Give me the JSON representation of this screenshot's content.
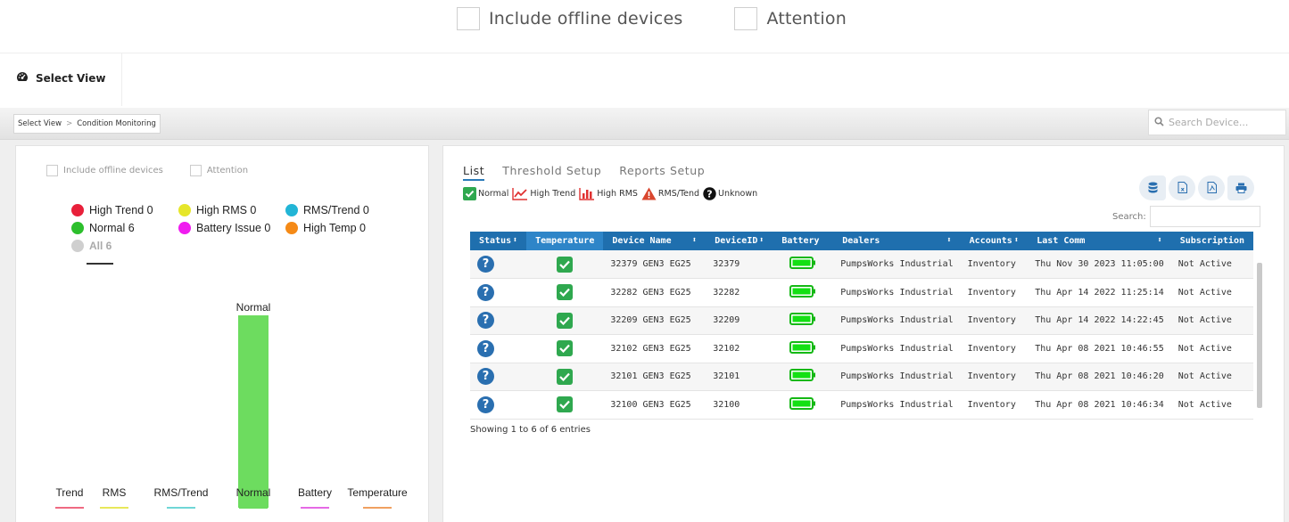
{
  "top_filters": {
    "include_offline_label": "Include offline devices",
    "attention_label": "Attention"
  },
  "header": {
    "title": "Select View",
    "title_icon": "dashboard-icon"
  },
  "breadcrumb": {
    "items": [
      "Select View",
      "Condition Monitoring"
    ],
    "separator": ">"
  },
  "search_device": {
    "placeholder": "Search Device..."
  },
  "left_panel": {
    "filters": {
      "include_offline_label": "Include offline devices",
      "attention_label": "Attention"
    },
    "legend": [
      {
        "label": "High Trend 0",
        "color": "#e8203a"
      },
      {
        "label": "High RMS 0",
        "color": "#e6e62a"
      },
      {
        "label": "RMS/Trend 0",
        "color": "#22b5d6"
      },
      {
        "label": "Normal 6",
        "color": "#2cbf2c"
      },
      {
        "label": "Battery Issue 0",
        "color": "#f01cf0"
      },
      {
        "label": "High Temp 0",
        "color": "#f58a17"
      }
    ],
    "all_label": "All 6"
  },
  "chart_data": {
    "type": "bar",
    "categories": [
      "Trend",
      "RMS",
      "RMS/Trend",
      "Normal",
      "Battery",
      "Temperature"
    ],
    "values": [
      0,
      0,
      0,
      6,
      0,
      0
    ],
    "bar_labels": [
      "",
      "",
      "",
      "Normal",
      "",
      ""
    ],
    "colors": [
      "#ef6a82",
      "#e8e85a",
      "#6fd6d6",
      "#6ddc5f",
      "#e56ae5",
      "#f0a060"
    ],
    "ylim": [
      0,
      6
    ],
    "grid": false
  },
  "right_panel": {
    "tabs": [
      "List",
      "Threshold Setup",
      "Reports Setup"
    ],
    "active_tab": "List",
    "status_legend": [
      "Normal",
      "High Trend",
      "High RMS",
      "RMS/Tend",
      "Unknown"
    ],
    "search_label": "Search:",
    "columns": [
      "Status",
      "Temperature",
      "Device Name",
      "DeviceID",
      "Battery",
      "Dealers",
      "Accounts",
      "Last Comm",
      "Subscription"
    ],
    "rows": [
      {
        "device_name": "32379 GEN3 EG25",
        "device_id": "32379",
        "dealer": "PumpsWorks Industrial",
        "account": "Inventory",
        "last_comm": "Thu Nov 30 2023 11:05:00",
        "subscription": "Not Active"
      },
      {
        "device_name": "32282 GEN3 EG25",
        "device_id": "32282",
        "dealer": "PumpsWorks Industrial",
        "account": "Inventory",
        "last_comm": "Thu Apr 14 2022 11:25:14",
        "subscription": "Not Active"
      },
      {
        "device_name": "32209 GEN3 EG25",
        "device_id": "32209",
        "dealer": "PumpsWorks Industrial",
        "account": "Inventory",
        "last_comm": "Thu Apr 14 2022 14:22:45",
        "subscription": "Not Active"
      },
      {
        "device_name": "32102 GEN3 EG25",
        "device_id": "32102",
        "dealer": "PumpsWorks Industrial",
        "account": "Inventory",
        "last_comm": "Thu Apr 08 2021 10:46:55",
        "subscription": "Not Active"
      },
      {
        "device_name": "32101 GEN3 EG25",
        "device_id": "32101",
        "dealer": "PumpsWorks Industrial",
        "account": "Inventory",
        "last_comm": "Thu Apr 08 2021 10:46:20",
        "subscription": "Not Active"
      },
      {
        "device_name": "32100 GEN3 EG25",
        "device_id": "32100",
        "dealer": "PumpsWorks Industrial",
        "account": "Inventory",
        "last_comm": "Thu Apr 08 2021 10:46:34",
        "subscription": "Not Active"
      }
    ],
    "showing_text": "Showing 1 to 6 of 6 entries"
  }
}
